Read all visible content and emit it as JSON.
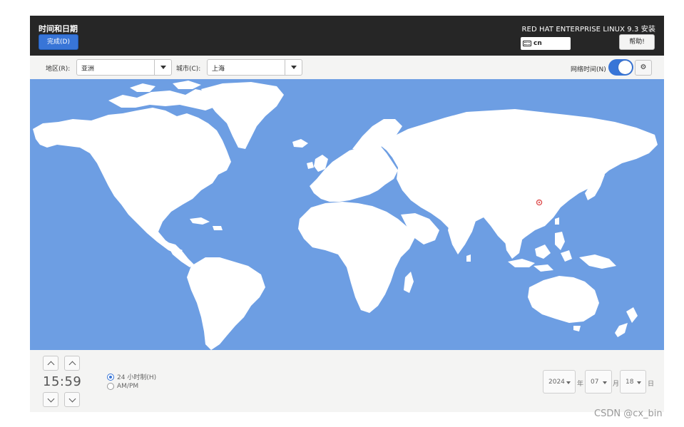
{
  "header": {
    "page_title": "时间和日期",
    "done_label": "完成(D)",
    "product_title": "RED HAT ENTERPRISE LINUX 9.3 安装",
    "keyboard_layout": "cn",
    "help_label": "帮助!"
  },
  "toolbar": {
    "region_label": "地区(R):",
    "region_value": "亚洲",
    "city_label": "城市(C):",
    "city_value": "上海",
    "network_time_label": "网络时间(N)",
    "network_time_enabled": true,
    "ntp_config_icon": "gear-icon"
  },
  "map": {
    "ocean_color": "#6d9ee3",
    "land_color": "#ffffff",
    "marker_color": "#e05a5a"
  },
  "time": {
    "display": "15:59",
    "format_24h_label": "24 小时制(H)",
    "format_ampm_label": "AM/PM",
    "selected_format": "24h"
  },
  "date": {
    "year": "2024",
    "year_unit": "年",
    "month": "07",
    "month_unit": "月",
    "day": "18",
    "day_unit": "日"
  },
  "colors": {
    "header_bg": "#262626",
    "accent": "#3875d7"
  },
  "watermark": "CSDN @cx_bin"
}
